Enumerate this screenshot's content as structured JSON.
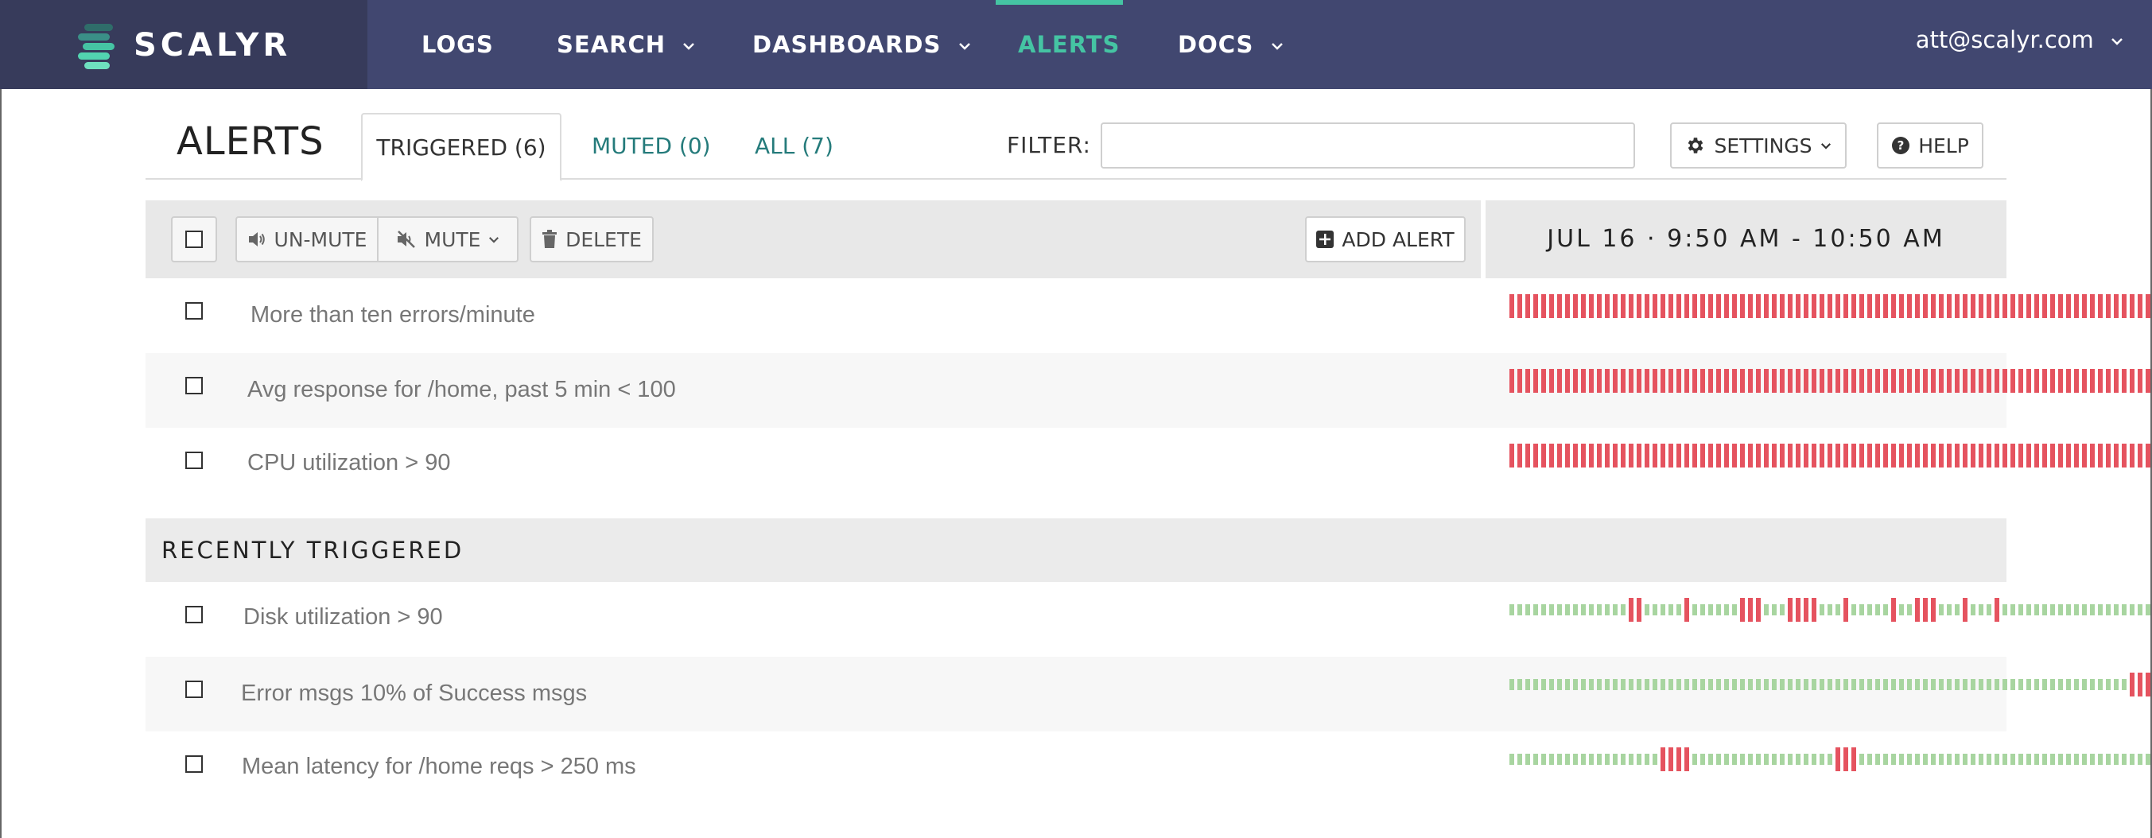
{
  "app": {
    "name": "SCALYR",
    "brand_colors": {
      "nav_bg": "#414770",
      "logo_bg": "#373b5b",
      "accent": "#45c4a3",
      "tab_link": "#257b7b",
      "alert_red": "#e5535f",
      "ok_green": "#a8d5a0"
    }
  },
  "nav": {
    "items": [
      {
        "label": "LOGS",
        "has_dropdown": false
      },
      {
        "label": "SEARCH",
        "has_dropdown": true
      },
      {
        "label": "DASHBOARDS",
        "has_dropdown": true
      },
      {
        "label": "ALERTS",
        "has_dropdown": false,
        "active": true
      },
      {
        "label": "DOCS",
        "has_dropdown": true
      }
    ],
    "user": "att@scalyr.com"
  },
  "page": {
    "title": "ALERTS",
    "tabs": [
      {
        "label": "TRIGGERED (6)",
        "active": true
      },
      {
        "label": "MUTED (0)"
      },
      {
        "label": "ALL (7)"
      }
    ],
    "filter_label": "FILTER:",
    "filter_value": "",
    "settings_label": "SETTINGS",
    "help_label": "HELP"
  },
  "toolbar": {
    "unmute_label": "UN-MUTE",
    "mute_label": "MUTE",
    "delete_label": "DELETE",
    "add_alert_label": "ADD ALERT",
    "time_range": "JUL 16 · 9:50 AM - 10:50 AM"
  },
  "triggered": [
    {
      "label": "More than ten errors/minute",
      "state": "all_triggered"
    },
    {
      "label": "Avg response for /home, past 5 min  < 100",
      "state": "all_triggered"
    },
    {
      "label": "CPU utilization > 90",
      "state": "all_triggered"
    }
  ],
  "recent_header": "RECENTLY TRIGGERED",
  "recent": [
    {
      "label": "Disk utilization > 90",
      "triggered_bar_indices": [
        15,
        16,
        22,
        29,
        30,
        31,
        35,
        36,
        37,
        38,
        42,
        48,
        51,
        52,
        53,
        57,
        61
      ]
    },
    {
      "label": "Error msgs 10% of Success msgs",
      "triggered_bar_indices": [
        78,
        79,
        80,
        81
      ]
    },
    {
      "label": "Mean latency for /home reqs > 250 ms",
      "triggered_bar_indices": [
        19,
        20,
        21,
        22,
        41,
        42,
        43
      ]
    }
  ],
  "timeline_bar_count": 87
}
